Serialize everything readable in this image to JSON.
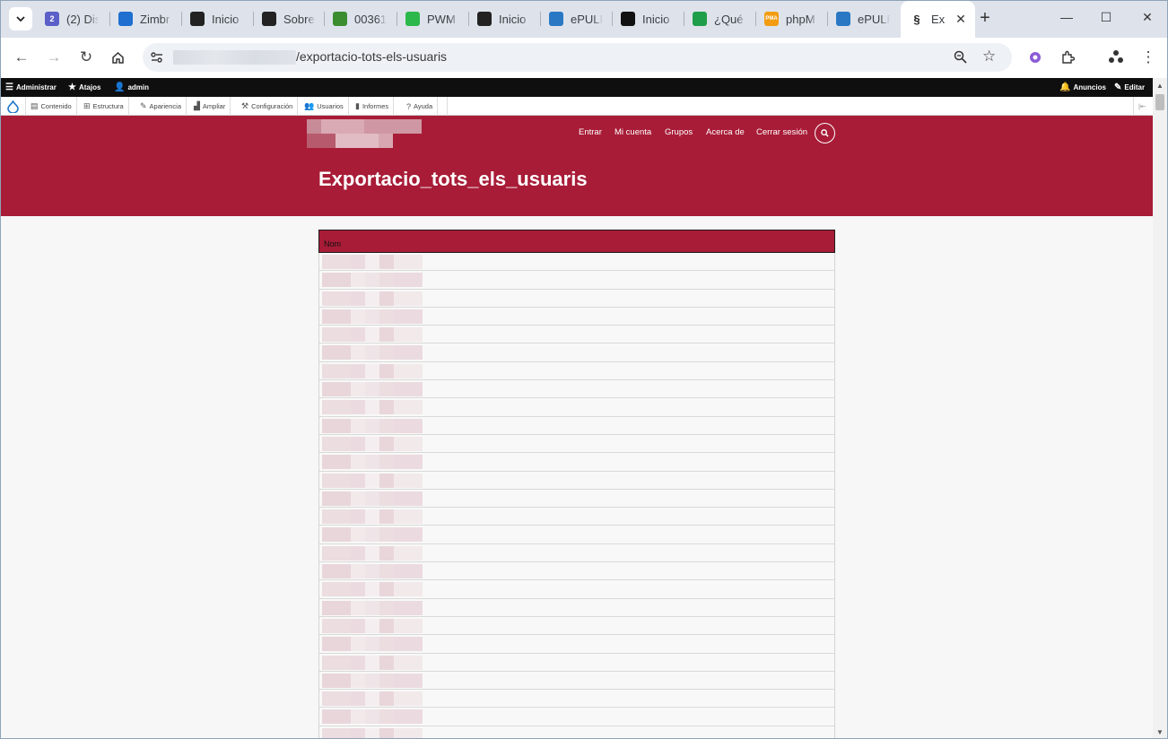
{
  "browser": {
    "tabs": [
      {
        "title": "(2) Dis",
        "icon": "chat-icon",
        "color": "#5b5fc7",
        "badge": "2"
      },
      {
        "title": "Zimbr",
        "icon": "zimbra-icon",
        "color": "#1e6fd0"
      },
      {
        "title": "Inicio",
        "icon": "drupal-icon",
        "color": "#222222"
      },
      {
        "title": "Sobre",
        "icon": "drupal-icon",
        "color": "#222222"
      },
      {
        "title": "00361",
        "icon": "puzzle-icon",
        "color": "#3c8d2f"
      },
      {
        "title": "PWM",
        "icon": "pwm-icon",
        "color": "#2db84b"
      },
      {
        "title": "Inicio",
        "icon": "drupal-icon",
        "color": "#222222"
      },
      {
        "title": "ePULF",
        "icon": "epul-icon",
        "color": "#2a78c4"
      },
      {
        "title": "Inicio",
        "icon": "lock-icon",
        "color": "#111111"
      },
      {
        "title": "¿Qué",
        "icon": "sheet-icon",
        "color": "#1e9e4a"
      },
      {
        "title": "phpM",
        "icon": "pma-icon",
        "color": "#f39c12",
        "label": "PMA"
      },
      {
        "title": "ePULF",
        "icon": "epul-icon",
        "color": "#2a78c4"
      }
    ],
    "active_tab": {
      "title": "Ex",
      "icon": "drupal-icon"
    },
    "new_tab": "+",
    "url_path": "/exportacio-tots-els-usuaris"
  },
  "admin_toolbar": {
    "items": [
      {
        "label": "Administrar",
        "icon": "menu-icon"
      },
      {
        "label": "Atajos",
        "icon": "star-icon"
      },
      {
        "label": "admin",
        "icon": "user-icon"
      }
    ],
    "right": [
      {
        "label": "Anuncios",
        "icon": "bell-icon"
      },
      {
        "label": "Editar",
        "icon": "pencil-icon"
      }
    ]
  },
  "tray": {
    "items": [
      {
        "label": "Contenido",
        "icon": "page-icon"
      },
      {
        "label": "Estructura",
        "icon": "sitemap-icon"
      },
      {
        "label": "Apariencia",
        "icon": "brush-icon"
      },
      {
        "label": "Ampliar",
        "icon": "puzzle-icon"
      },
      {
        "label": "Configuración",
        "icon": "wrench-icon"
      },
      {
        "label": "Usuarios",
        "icon": "people-icon"
      },
      {
        "label": "Informes",
        "icon": "bars-icon"
      },
      {
        "label": "Ayuda",
        "icon": "help-icon"
      }
    ]
  },
  "site": {
    "nav": [
      "Entrar",
      "Mi cuenta",
      "Grupos",
      "Acerca de",
      "Cerrar sesión"
    ],
    "page_title": "Exportacio_tots_els_usuaris",
    "brand_color": "#a81c37"
  },
  "table": {
    "header": "Nom",
    "row_count": 27
  }
}
